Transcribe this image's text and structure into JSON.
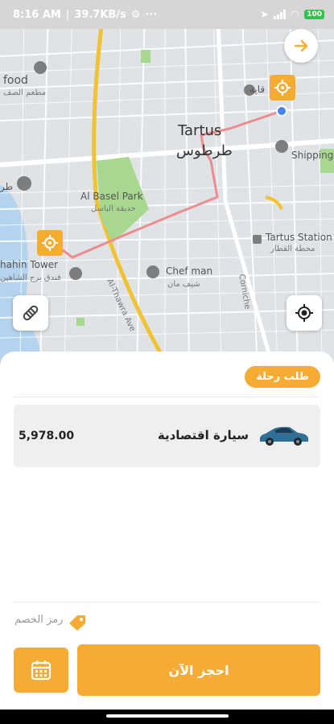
{
  "status_bar": {
    "time": "8:16 AM",
    "speed": "39.7KB/s",
    "battery": "100"
  },
  "map": {
    "labels": {
      "city_en": "Tartus",
      "city_ar": "طرطوس",
      "park_en": "Al Basel Park",
      "park_ar": "حديقة الباسل",
      "food": "food",
      "food_ar": "مطعم الصف",
      "tower": "hahin Tower",
      "tower_ar": "فندق برج الشاهين",
      "chef_en": "Chef man",
      "chef_ar": "شيف مان",
      "shipping": "Shipping c",
      "station_en": "Tartus Station",
      "station_ar": "محطة القطار",
      "road1": "Al-Thawra Ave",
      "road2": "Corniche",
      "tl": "طر",
      "saqlia": "قاية"
    }
  },
  "sheet": {
    "request_tag": "طلب رحلة",
    "vehicle": {
      "name": "سيارة اقتصادية",
      "price": "5,978.00"
    },
    "promo_label": "رمز الخصم",
    "book_label": "احجز الآن"
  },
  "colors": {
    "accent": "#f6ac34",
    "route": "#ef8b8f",
    "road_main": "#f1c232"
  }
}
